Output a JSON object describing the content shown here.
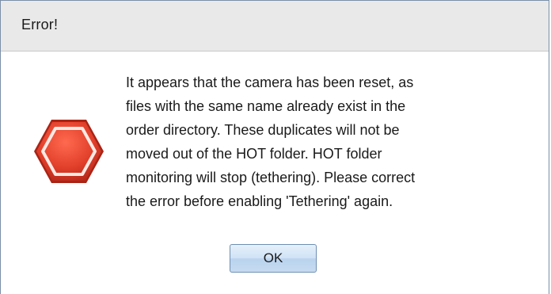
{
  "dialog": {
    "title": "Error!",
    "icon": "error-octagon-icon",
    "message": "It appears that the camera has been reset, as\nfiles with the same name already exist in the\norder directory. These duplicates will not be\nmoved out of the HOT folder. HOT folder\nmonitoring will stop (tethering).  Please correct\nthe error before enabling 'Tethering' again.",
    "ok_label": "OK"
  },
  "colors": {
    "titlebar": "#e9e9e9",
    "icon_red": "#e0392a",
    "button_border": "#6f8fb2"
  }
}
